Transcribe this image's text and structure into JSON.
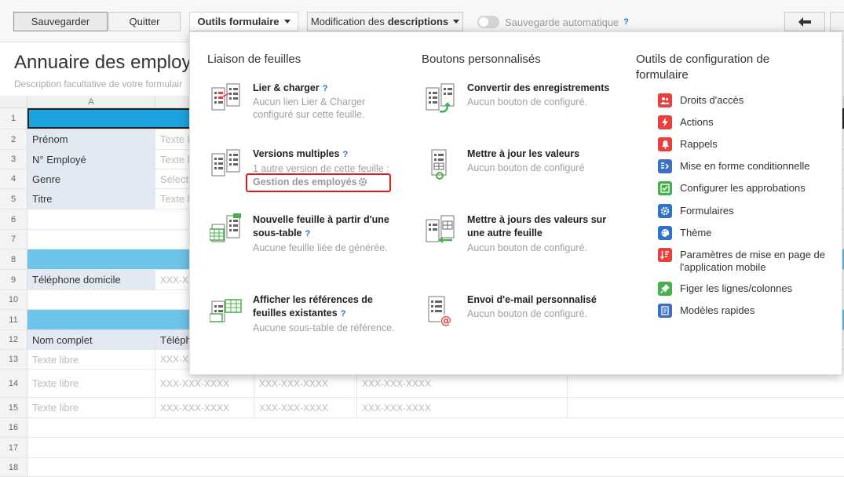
{
  "toolbar": {
    "save": "Sauvegarder",
    "quit": "Quitter",
    "form_tools": "Outils formulaire",
    "desc_prefix": "Modification des",
    "desc_bold": "descriptions",
    "autosave": "Sauvegarde automatique",
    "autosave_help": "?"
  },
  "form": {
    "title": "Annuaire des employé",
    "description": "Description facultative de votre formulair"
  },
  "grid": {
    "col_a": "A",
    "rows": {
      "r1": "1",
      "r2": "2",
      "r3": "3",
      "r4": "4",
      "r5": "5",
      "r6": "6",
      "r7": "7",
      "r8": "8",
      "r9": "9",
      "r10": "10",
      "r11": "11",
      "r12": "12",
      "r13": "13",
      "r14": "14",
      "r15": "15",
      "r16": "16",
      "r17": "17",
      "r18": "18"
    },
    "labels": {
      "prenom": "Prénom",
      "employe": "N° Employé",
      "genre": "Genre",
      "titre": "Titre",
      "tel": "Téléphone domicile",
      "nom": "Nom complet",
      "telh": "Téléph"
    },
    "placeholders": {
      "texte_l": "Texte l",
      "selecti": "Sélecti",
      "xxx_short": "XXX-XX",
      "texte_libre": "Texte libre",
      "xxx": "XXX-XXX-XXXX"
    }
  },
  "panel": {
    "col1_title": "Liaison de feuilles",
    "col2_title": "Boutons personnalisés",
    "col3_title": "Outils de configuration de formulaire",
    "help": "?",
    "items": {
      "link_load": {
        "title": "Lier & charger",
        "desc": "Aucun lien Lier & Charger configuré sur cette feuille."
      },
      "versions": {
        "title": "Versions multiples",
        "desc": "1 autre version de cette feuille :",
        "link": "Gestion des employés"
      },
      "new_sheet": {
        "title": "Nouvelle feuille à partir d'une sous-table",
        "desc": "Aucune feuille liée de générée."
      },
      "references": {
        "title": "Afficher les références de feuilles existantes",
        "desc": "Aucune sous-table de référence."
      },
      "convert": {
        "title": "Convertir des enregistrements",
        "desc": "Aucun bouton de configuré."
      },
      "update": {
        "title": "Mettre à jour les valeurs",
        "desc": "Aucun bouton de configuré"
      },
      "update_other": {
        "title": "Mettre à jours des valeurs sur une autre feuille",
        "desc": "Aucun bouton de configuré."
      },
      "email": {
        "title": "Envoi d'e-mail personnalisé",
        "desc": "Aucun bouton de configuré."
      }
    },
    "config": {
      "access": "Droits d'accès",
      "actions": "Actions",
      "reminders": "Rappels",
      "conditional": "Mise en forme conditionnelle",
      "approvals": "Configurer les approbations",
      "forms": "Formulaires",
      "theme": "Thème",
      "mobile": "Paramètres de mise en page de l'application mobile",
      "freeze": "Figer les lignes/colonnes",
      "templates": "Modèles rapides"
    }
  },
  "colors": {
    "access": "#e8413c",
    "actions": "#e8413c",
    "reminders": "#e8413c",
    "conditional": "#3d6fc4",
    "approvals": "#47b04b",
    "forms": "#2e73c9",
    "theme": "#2e73c9",
    "mobile": "#e8413c",
    "freeze": "#47b04b",
    "templates": "#3d6fc4"
  }
}
